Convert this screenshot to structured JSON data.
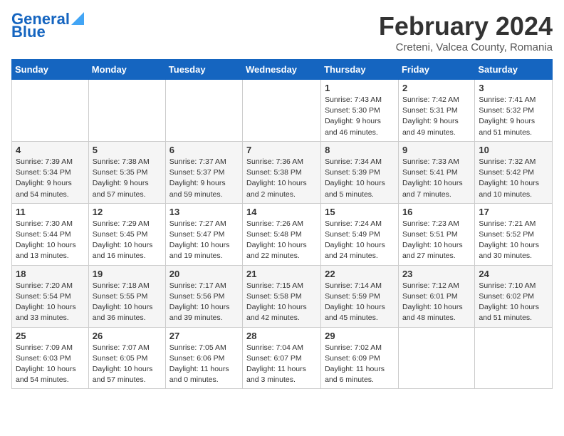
{
  "logo": {
    "text1": "General",
    "text2": "Blue"
  },
  "title": "February 2024",
  "location": "Creteni, Valcea County, Romania",
  "days_of_week": [
    "Sunday",
    "Monday",
    "Tuesday",
    "Wednesday",
    "Thursday",
    "Friday",
    "Saturday"
  ],
  "weeks": [
    [
      {
        "day": "",
        "info": ""
      },
      {
        "day": "",
        "info": ""
      },
      {
        "day": "",
        "info": ""
      },
      {
        "day": "",
        "info": ""
      },
      {
        "day": "1",
        "info": "Sunrise: 7:43 AM\nSunset: 5:30 PM\nDaylight: 9 hours\nand 46 minutes."
      },
      {
        "day": "2",
        "info": "Sunrise: 7:42 AM\nSunset: 5:31 PM\nDaylight: 9 hours\nand 49 minutes."
      },
      {
        "day": "3",
        "info": "Sunrise: 7:41 AM\nSunset: 5:32 PM\nDaylight: 9 hours\nand 51 minutes."
      }
    ],
    [
      {
        "day": "4",
        "info": "Sunrise: 7:39 AM\nSunset: 5:34 PM\nDaylight: 9 hours\nand 54 minutes."
      },
      {
        "day": "5",
        "info": "Sunrise: 7:38 AM\nSunset: 5:35 PM\nDaylight: 9 hours\nand 57 minutes."
      },
      {
        "day": "6",
        "info": "Sunrise: 7:37 AM\nSunset: 5:37 PM\nDaylight: 9 hours\nand 59 minutes."
      },
      {
        "day": "7",
        "info": "Sunrise: 7:36 AM\nSunset: 5:38 PM\nDaylight: 10 hours\nand 2 minutes."
      },
      {
        "day": "8",
        "info": "Sunrise: 7:34 AM\nSunset: 5:39 PM\nDaylight: 10 hours\nand 5 minutes."
      },
      {
        "day": "9",
        "info": "Sunrise: 7:33 AM\nSunset: 5:41 PM\nDaylight: 10 hours\nand 7 minutes."
      },
      {
        "day": "10",
        "info": "Sunrise: 7:32 AM\nSunset: 5:42 PM\nDaylight: 10 hours\nand 10 minutes."
      }
    ],
    [
      {
        "day": "11",
        "info": "Sunrise: 7:30 AM\nSunset: 5:44 PM\nDaylight: 10 hours\nand 13 minutes."
      },
      {
        "day": "12",
        "info": "Sunrise: 7:29 AM\nSunset: 5:45 PM\nDaylight: 10 hours\nand 16 minutes."
      },
      {
        "day": "13",
        "info": "Sunrise: 7:27 AM\nSunset: 5:47 PM\nDaylight: 10 hours\nand 19 minutes."
      },
      {
        "day": "14",
        "info": "Sunrise: 7:26 AM\nSunset: 5:48 PM\nDaylight: 10 hours\nand 22 minutes."
      },
      {
        "day": "15",
        "info": "Sunrise: 7:24 AM\nSunset: 5:49 PM\nDaylight: 10 hours\nand 24 minutes."
      },
      {
        "day": "16",
        "info": "Sunrise: 7:23 AM\nSunset: 5:51 PM\nDaylight: 10 hours\nand 27 minutes."
      },
      {
        "day": "17",
        "info": "Sunrise: 7:21 AM\nSunset: 5:52 PM\nDaylight: 10 hours\nand 30 minutes."
      }
    ],
    [
      {
        "day": "18",
        "info": "Sunrise: 7:20 AM\nSunset: 5:54 PM\nDaylight: 10 hours\nand 33 minutes."
      },
      {
        "day": "19",
        "info": "Sunrise: 7:18 AM\nSunset: 5:55 PM\nDaylight: 10 hours\nand 36 minutes."
      },
      {
        "day": "20",
        "info": "Sunrise: 7:17 AM\nSunset: 5:56 PM\nDaylight: 10 hours\nand 39 minutes."
      },
      {
        "day": "21",
        "info": "Sunrise: 7:15 AM\nSunset: 5:58 PM\nDaylight: 10 hours\nand 42 minutes."
      },
      {
        "day": "22",
        "info": "Sunrise: 7:14 AM\nSunset: 5:59 PM\nDaylight: 10 hours\nand 45 minutes."
      },
      {
        "day": "23",
        "info": "Sunrise: 7:12 AM\nSunset: 6:01 PM\nDaylight: 10 hours\nand 48 minutes."
      },
      {
        "day": "24",
        "info": "Sunrise: 7:10 AM\nSunset: 6:02 PM\nDaylight: 10 hours\nand 51 minutes."
      }
    ],
    [
      {
        "day": "25",
        "info": "Sunrise: 7:09 AM\nSunset: 6:03 PM\nDaylight: 10 hours\nand 54 minutes."
      },
      {
        "day": "26",
        "info": "Sunrise: 7:07 AM\nSunset: 6:05 PM\nDaylight: 10 hours\nand 57 minutes."
      },
      {
        "day": "27",
        "info": "Sunrise: 7:05 AM\nSunset: 6:06 PM\nDaylight: 11 hours\nand 0 minutes."
      },
      {
        "day": "28",
        "info": "Sunrise: 7:04 AM\nSunset: 6:07 PM\nDaylight: 11 hours\nand 3 minutes."
      },
      {
        "day": "29",
        "info": "Sunrise: 7:02 AM\nSunset: 6:09 PM\nDaylight: 11 hours\nand 6 minutes."
      },
      {
        "day": "",
        "info": ""
      },
      {
        "day": "",
        "info": ""
      }
    ]
  ]
}
